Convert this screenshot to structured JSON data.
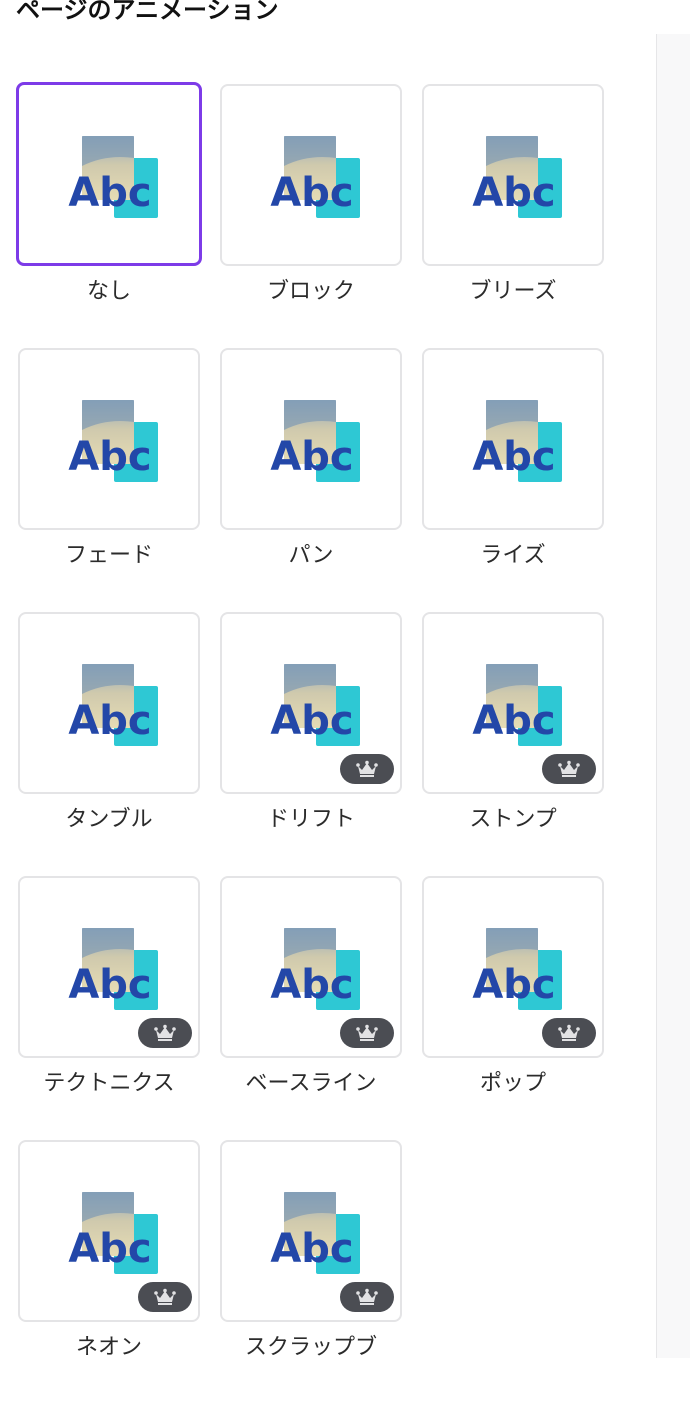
{
  "header": {
    "title": "ページのアニメーション"
  },
  "colors": {
    "selected_border": "#7d3be8",
    "tile_border": "#e4e4e6",
    "badge_bg": "#4b4d53",
    "art_text": "#2347a8",
    "art_teal": "#2ec8d4"
  },
  "preview": {
    "text": "Abc",
    "icon": "abc-preview-icon"
  },
  "animations": [
    {
      "label": "なし",
      "selected": true,
      "premium": false
    },
    {
      "label": "ブロック",
      "selected": false,
      "premium": false
    },
    {
      "label": "ブリーズ",
      "selected": false,
      "premium": false
    },
    {
      "label": "フェード",
      "selected": false,
      "premium": false
    },
    {
      "label": "パン",
      "selected": false,
      "premium": false
    },
    {
      "label": "ライズ",
      "selected": false,
      "premium": false
    },
    {
      "label": "タンブル",
      "selected": false,
      "premium": false
    },
    {
      "label": "ドリフト",
      "selected": false,
      "premium": true
    },
    {
      "label": "ストンプ",
      "selected": false,
      "premium": true
    },
    {
      "label": "テクトニクス",
      "selected": false,
      "premium": true
    },
    {
      "label": "ベースライン",
      "selected": false,
      "premium": true
    },
    {
      "label": "ポップ",
      "selected": false,
      "premium": true
    },
    {
      "label": "ネオン",
      "selected": false,
      "premium": true
    },
    {
      "label": "スクラップブ",
      "selected": false,
      "premium": true
    }
  ],
  "premium_badge": {
    "icon": "crown-icon"
  }
}
